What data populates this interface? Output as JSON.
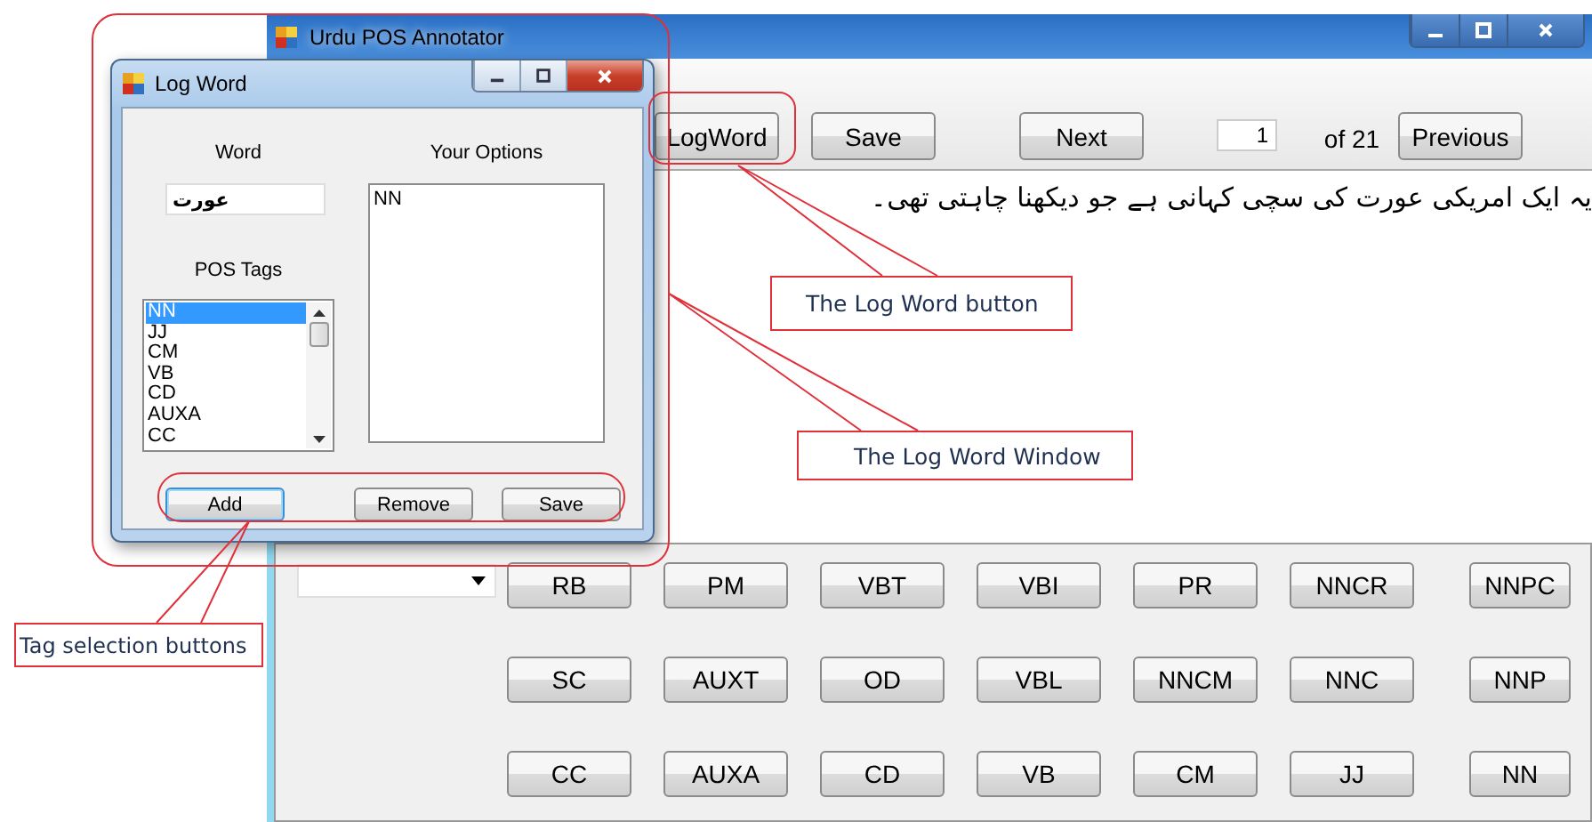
{
  "main_window": {
    "title": "Urdu POS Annotator",
    "toolbar_buttons": [
      {
        "label": "LogWord"
      },
      {
        "label": "Save"
      },
      {
        "label": "Next"
      }
    ],
    "page_field": {
      "value": "1"
    },
    "page_count": "of 21",
    "previous_button": "Previous",
    "sentence": "یہ ایک امریکی عورت کی سچی کہانی ہے جو دیکھنا چاہتی تھی۔",
    "tag_buttons": [
      [
        "RB",
        "PM",
        "VBT",
        "VBI",
        "PR",
        "NNCR",
        "NNPC"
      ],
      [
        "SC",
        "AUXT",
        "OD",
        "VBL",
        "NNCM",
        "NNC",
        "NNP"
      ],
      [
        "CC",
        "AUXA",
        "CD",
        "VB",
        "CM",
        "JJ",
        "NN"
      ]
    ]
  },
  "log_word_window": {
    "title": "Log Word",
    "word_label": "Word",
    "word_value": "عورت",
    "options_label": "Your Options",
    "options": [
      "NN"
    ],
    "pos_tags_label": "POS Tags",
    "pos_tags": [
      {
        "label": "NN",
        "selected": true
      },
      {
        "label": "JJ",
        "selected": false
      },
      {
        "label": "CM",
        "selected": false
      },
      {
        "label": "VB",
        "selected": false
      },
      {
        "label": "CD",
        "selected": false
      },
      {
        "label": "AUXA",
        "selected": false
      },
      {
        "label": "CC",
        "selected": false
      }
    ],
    "buttons": [
      {
        "label": "Add",
        "focused": true
      },
      {
        "label": "Remove",
        "focused": false
      },
      {
        "label": "Save",
        "focused": false
      }
    ]
  },
  "annotations": [
    {
      "text": "The Log Word button"
    },
    {
      "text": "The Log Word Window"
    },
    {
      "text": "Tag selection buttons"
    }
  ]
}
